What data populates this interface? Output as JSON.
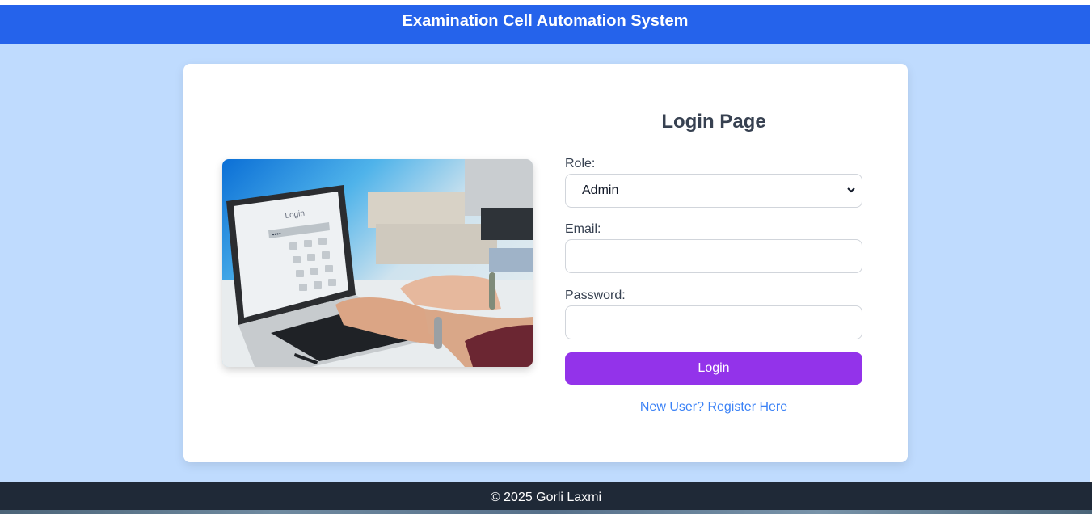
{
  "header": {
    "title": "Examination Cell Automation System"
  },
  "login": {
    "title": "Login Page",
    "role_label": "Role:",
    "role_selected": "Admin",
    "email_label": "Email:",
    "email_value": "",
    "password_label": "Password:",
    "password_value": "",
    "login_button": "Login",
    "register_link": "New User? Register Here"
  },
  "image": {
    "screen_text": "Login",
    "screen_password_mask": "••••",
    "keypad": [
      "1",
      "2",
      "3",
      "4",
      "5",
      "6",
      "7",
      "8",
      "9",
      "*",
      "0",
      "#"
    ]
  },
  "footer": {
    "text": "© 2025 Gorli Laxmi"
  },
  "colors": {
    "page_bg": "#bfdbfe",
    "header_bg": "#2563eb",
    "button_bg": "#9333ea",
    "link": "#3b82f6",
    "footer_bg": "#1f2937"
  }
}
